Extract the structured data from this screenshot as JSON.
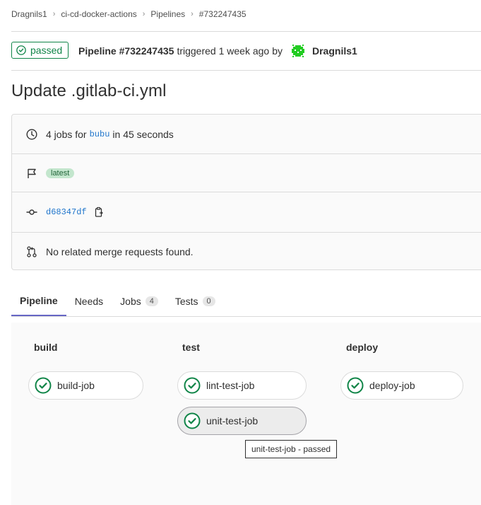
{
  "breadcrumb": [
    "Dragnils1",
    "ci-cd-docker-actions",
    "Pipelines",
    "#732247435"
  ],
  "status": {
    "label": "passed"
  },
  "header": {
    "pipeline_label": "Pipeline #732247435",
    "triggered_text": "triggered 1 week ago",
    "by_text": "by",
    "author": "Dragnils1"
  },
  "title": "Update .gitlab-ci.yml",
  "info": {
    "jobs_prefix": "4 jobs for",
    "branch": "bubu",
    "duration_text": "in 45 seconds",
    "tag": "latest",
    "commit_sha": "d68347df",
    "merge_requests": "No related merge requests found."
  },
  "tabs": [
    {
      "label": "Pipeline"
    },
    {
      "label": "Needs"
    },
    {
      "label": "Jobs",
      "count": "4"
    },
    {
      "label": "Tests",
      "count": "0"
    }
  ],
  "stages": [
    {
      "name": "build",
      "jobs": [
        "build-job"
      ]
    },
    {
      "name": "test",
      "jobs": [
        "lint-test-job",
        "unit-test-job"
      ]
    },
    {
      "name": "deploy",
      "jobs": [
        "deploy-job"
      ]
    }
  ],
  "tooltip": "unit-test-job - passed",
  "colors": {
    "success": "#108548",
    "tab_active": "#6666c4",
    "link": "#1f75cb"
  }
}
